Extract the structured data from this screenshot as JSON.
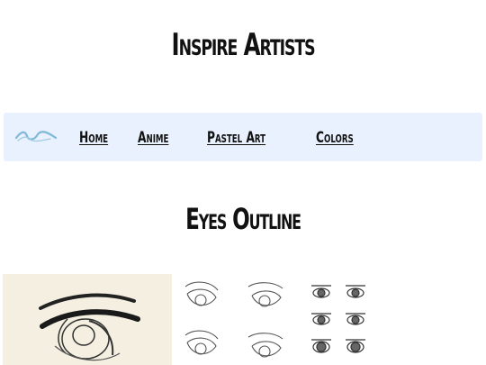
{
  "header": {
    "title": "Inspire Artists"
  },
  "nav": {
    "home": "Home",
    "anime": "Anime",
    "pastel_art": "Pastel Art",
    "colors": "Colors"
  },
  "section": {
    "heading": "Eyes Outline"
  },
  "colors": {
    "nav_background": "#e8f1fd",
    "logo_stroke": "#7fb8d8",
    "image_background": "#f4efe1"
  }
}
